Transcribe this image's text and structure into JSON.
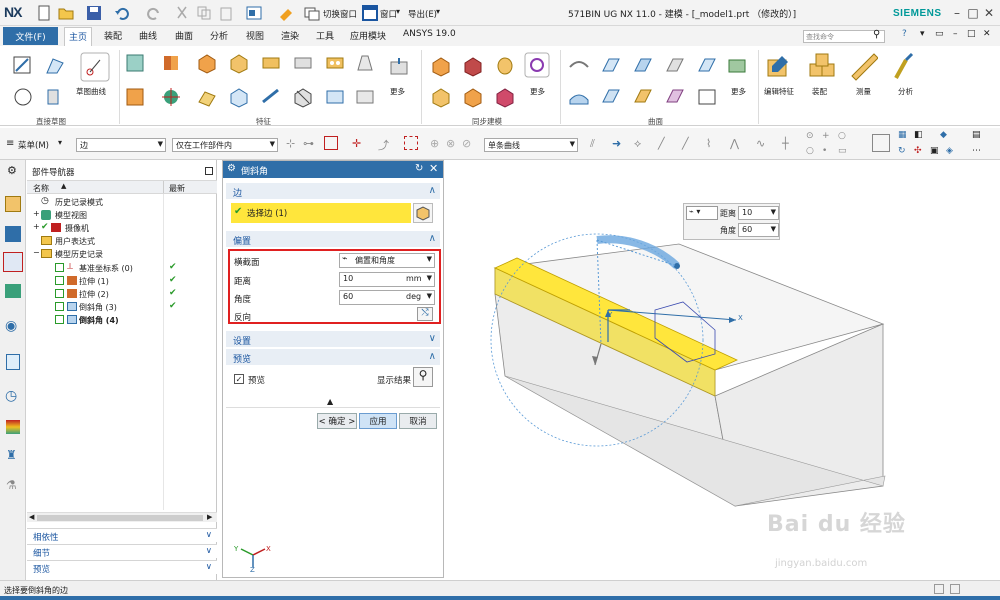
{
  "app": {
    "logo": "NX",
    "title": "571BIN UG NX 11.0 - 建模 - [_model1.prt （修改的）]",
    "brand": "SIEMENS",
    "quick_access": {
      "switch_window": "切换窗口",
      "window": "窗口",
      "export": "导出(E)"
    }
  },
  "ribbon": {
    "file_tab": "文件(F)",
    "tabs": [
      "主页",
      "装配",
      "曲线",
      "曲面",
      "分析",
      "视图",
      "渲染",
      "工具",
      "应用模块",
      "ANSYS 19.0"
    ],
    "active_tab": "主页",
    "search_placeholder": "查找命令",
    "groups": {
      "direct_sketch": "直接草图",
      "feature": "特征",
      "sync_modeling": "同步建模",
      "surface": "曲面"
    },
    "buttons": {
      "sketch_curve": "草图曲线",
      "more1": "更多",
      "more2": "更多",
      "more3": "更多",
      "edit_feature": "编辑特征",
      "assembly": "装配",
      "measure": "测量",
      "analysis": "分析"
    }
  },
  "selection_bar": {
    "menu": "菜单(M)",
    "edge_filter": "边",
    "scope": "仅在工作部件内",
    "curve_rule": "单条曲线"
  },
  "navigator": {
    "title": "部件导航器",
    "col_name": "名称",
    "col_latest": "最新",
    "rows": [
      {
        "label": "历史记录模式",
        "indent": 0
      },
      {
        "label": "模型视图",
        "indent": 0
      },
      {
        "label": "摄像机",
        "indent": 0
      },
      {
        "label": "用户表达式",
        "indent": 0
      },
      {
        "label": "模型历史记录",
        "indent": 0
      },
      {
        "label": "基准坐标系 (0)",
        "indent": 1
      },
      {
        "label": "拉伸 (1)",
        "indent": 1
      },
      {
        "label": "拉伸 (2)",
        "indent": 1
      },
      {
        "label": "倒斜角 (3)",
        "indent": 1
      },
      {
        "label": "倒斜角 (4)",
        "indent": 1
      }
    ],
    "bottom": [
      "相依性",
      "细节",
      "预览"
    ]
  },
  "dialog": {
    "title": "倒斜角",
    "edge_section": "边",
    "select_edge": "选择边 (1)",
    "offset_section": "偏置",
    "cross_section_label": "横截面",
    "cross_section_value": "偏置和角度",
    "distance_label": "距离",
    "distance_value": "10",
    "distance_unit": "mm",
    "angle_label": "角度",
    "angle_value": "60",
    "angle_unit": "deg",
    "reverse_label": "反向",
    "settings_section": "设置",
    "preview_section": "预览",
    "preview_checkbox": "预览",
    "show_result": "显示结果",
    "ok": "< 确定 >",
    "apply": "应用",
    "cancel": "取消"
  },
  "floating": {
    "distance_label": "距离",
    "distance_value": "10",
    "angle_label": "角度",
    "angle_value": "60"
  },
  "axes": {
    "x": "X",
    "y": "Y",
    "z": "Z"
  },
  "watermark": {
    "brand": "Bai du 经验",
    "url": "jingyan.baidu.com"
  },
  "status": "选择要倒斜角的边",
  "colors": {
    "accent": "#2f6ea8",
    "highlight": "#ffe63c",
    "check": "#2a9a2a",
    "red_box": "#e02020"
  }
}
